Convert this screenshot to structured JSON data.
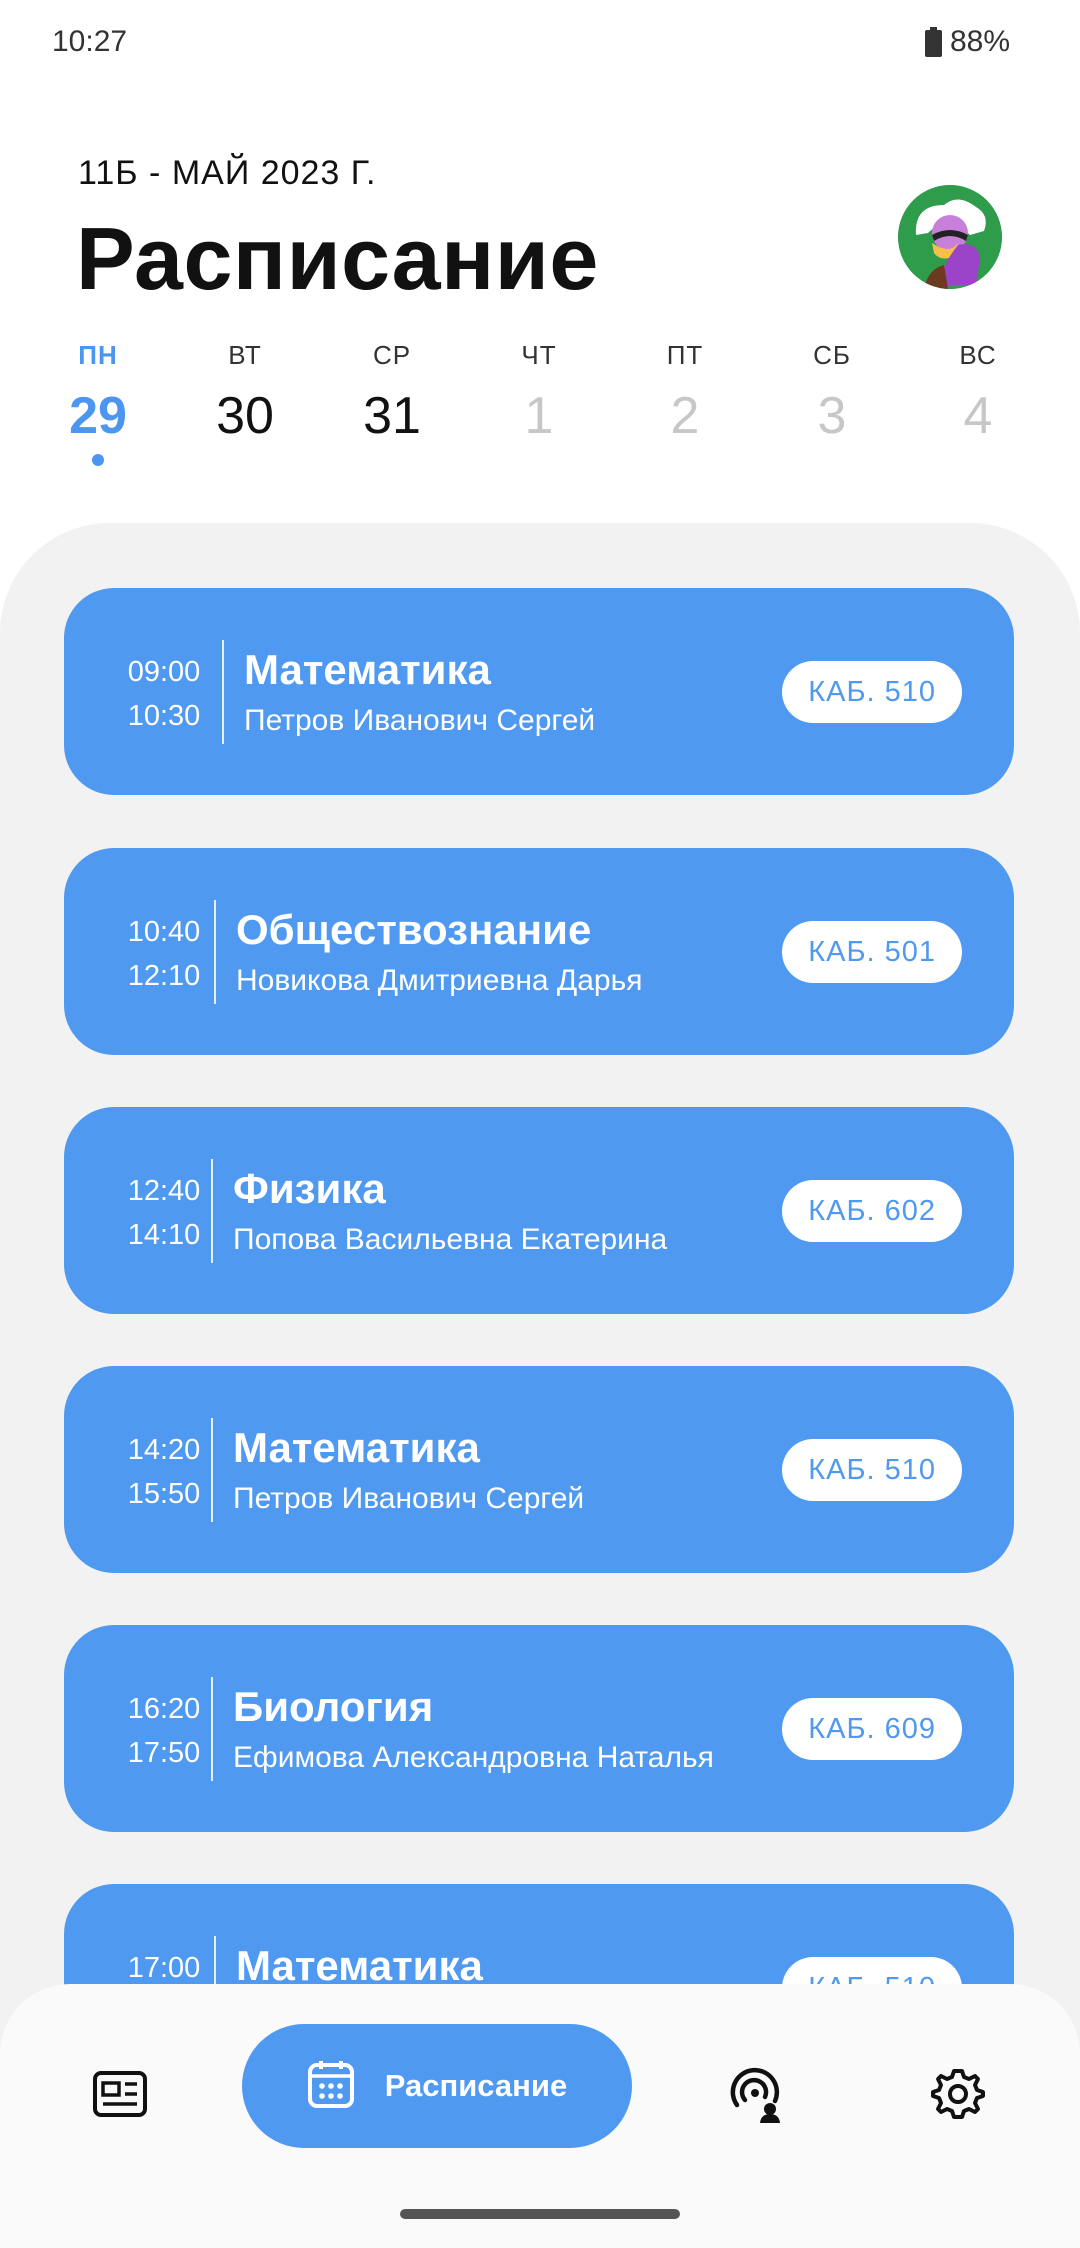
{
  "status": {
    "time": "10:27",
    "battery": "88%"
  },
  "header": {
    "subtitle": "11Б - МАЙ 2023 Г.",
    "title": "Расписание"
  },
  "week": [
    {
      "name": "ПН",
      "num": "29",
      "state": "active"
    },
    {
      "name": "ВТ",
      "num": "30",
      "state": "normal"
    },
    {
      "name": "СР",
      "num": "31",
      "state": "normal"
    },
    {
      "name": "ЧТ",
      "num": "1",
      "state": "future"
    },
    {
      "name": "ПТ",
      "num": "2",
      "state": "future"
    },
    {
      "name": "СБ",
      "num": "3",
      "state": "future"
    },
    {
      "name": "ВС",
      "num": "4",
      "state": "future"
    }
  ],
  "lessons": [
    {
      "start": "09:00",
      "end": "10:30",
      "subject": "Математика",
      "teacher": "Петров Иванович Сергей",
      "room": "КАБ. 510"
    },
    {
      "start": "10:40",
      "end": "12:10",
      "subject": "Обществознание",
      "teacher": "Новикова Дмитриевна Дарья",
      "room": "КАБ. 501"
    },
    {
      "start": "12:40",
      "end": "14:10",
      "subject": "Физика",
      "teacher": "Попова Васильевна Екатерина",
      "room": "КАБ. 602"
    },
    {
      "start": "14:20",
      "end": "15:50",
      "subject": "Математика",
      "teacher": "Петров Иванович Сергей",
      "room": "КАБ. 510"
    },
    {
      "start": "16:20",
      "end": "17:50",
      "subject": "Биология",
      "teacher": "Ефимова Александровна Наталья",
      "room": "КАБ. 609"
    },
    {
      "start": "17:00",
      "end": "",
      "subject": "Математика",
      "teacher": "",
      "room": "КАБ. 510"
    }
  ],
  "nav": {
    "items": [
      "news-icon",
      "calendar-icon",
      "podcast-user-icon",
      "gear-icon"
    ],
    "active_label": "Расписание"
  },
  "colors": {
    "accent": "#4f99f1",
    "active_day": "#4d96ef",
    "background": "#f2f2f2"
  }
}
